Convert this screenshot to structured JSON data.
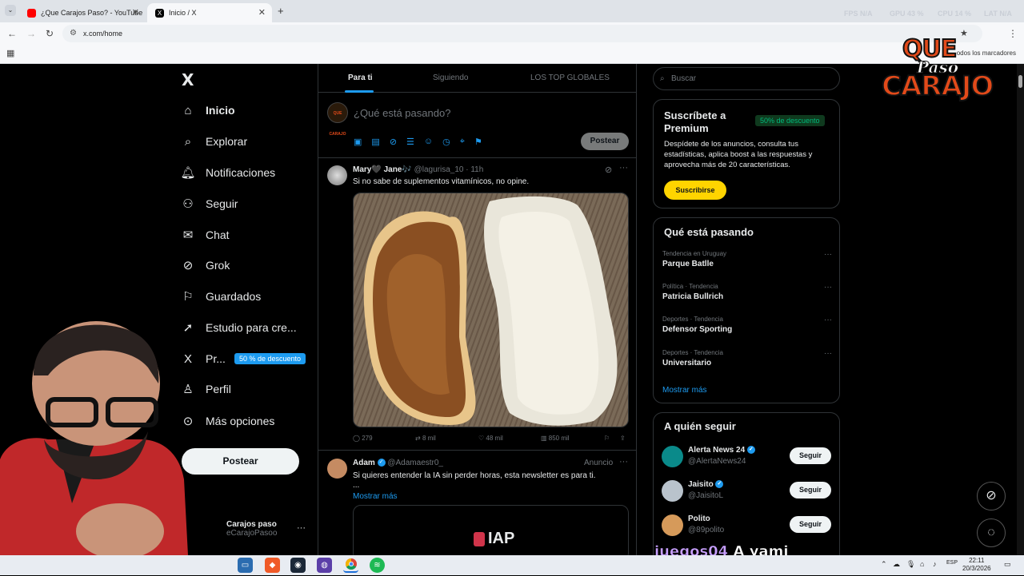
{
  "browser": {
    "tabs": [
      {
        "title": "¿Que Carajos Paso? - YouTube"
      },
      {
        "title": "Inicio / X"
      }
    ],
    "url": "x.com/home",
    "bookmarks_label": "odos los marcadores",
    "stats": {
      "fps": "FPS",
      "fps_val": "N/A",
      "gpu": "GPU",
      "gpu_val": "43 %",
      "cpu": "CPU",
      "cpu_val": "14 %",
      "lat": "LAT",
      "lat_val": "N/A"
    }
  },
  "overlay_logo": {
    "line1": "QUE",
    "line2": "Paso",
    "line3": "CARAJO"
  },
  "sidebar": {
    "logo": "X",
    "items": [
      {
        "label": "Inicio",
        "icon": "home-icon"
      },
      {
        "label": "Explorar",
        "icon": "search-icon"
      },
      {
        "label": "Notificaciones",
        "icon": "bell-icon"
      },
      {
        "label": "Seguir",
        "icon": "add-user-icon"
      },
      {
        "label": "Chat",
        "icon": "mail-icon"
      },
      {
        "label": "Grok",
        "icon": "grok-icon"
      },
      {
        "label": "Guardados",
        "icon": "bookmark-icon"
      },
      {
        "label": "Estudio para cre...",
        "icon": "rocket-icon"
      },
      {
        "label": "Pr...",
        "icon": "x-icon"
      },
      {
        "label": "Perfil",
        "icon": "person-icon"
      },
      {
        "label": "Más opciones",
        "icon": "more-icon"
      }
    ],
    "premium_badge": "50 % de descuento",
    "post_button": "Postear",
    "account": {
      "name": "Carajos paso",
      "handle": "eCarajoPasoo"
    }
  },
  "feed": {
    "tabs": [
      "Para ti",
      "Siguiendo",
      "LOS TOP GLOBALES"
    ],
    "compose": {
      "placeholder": "¿Qué está pasando?",
      "post_label": "Postear",
      "avatar_text": "QUE CARAJO"
    },
    "tweets": [
      {
        "name": "Mary🖤 Jane🎶",
        "handle": "@lagurisa_10",
        "time": "· 11h",
        "text": "Si no sabe de suplementos vitamínicos, no opine.",
        "replies": "279",
        "reposts": "8 mil",
        "likes": "48 mil",
        "views": "850 mil"
      },
      {
        "name": "Adam",
        "handle": "@Adamaestr0_",
        "ad_label": "Anuncio",
        "text": "Si quieres entender la IA sin perder horas, esta newsletter es para ti.",
        "ellipsis": "...",
        "more_link": "Mostrar más",
        "media_logo": "IAP"
      }
    ]
  },
  "right": {
    "search_placeholder": "Buscar",
    "premium": {
      "title": "Suscríbete a Premium",
      "badge": "50% de descuento",
      "text": "Despídete de los anuncios, consulta tus estadísticas, aplica boost a las respuestas y aprovecha más de 20 características.",
      "button": "Suscribirse"
    },
    "trends": {
      "title": "Qué está pasando",
      "items": [
        {
          "category": "Tendencia en Uruguay",
          "topic": "Parque Batlle"
        },
        {
          "category": "Política · Tendencia",
          "topic": "Patricia Bullrich"
        },
        {
          "category": "Deportes · Tendencia",
          "topic": "Defensor Sporting"
        },
        {
          "category": "Deportes · Tendencia",
          "topic": "Universitario"
        }
      ],
      "more": "Mostrar más"
    },
    "who_to_follow": {
      "title": "A quién seguir",
      "items": [
        {
          "name": "Alerta News 24",
          "handle": "@AlertaNews24",
          "button": "Seguir"
        },
        {
          "name": "Jaisito",
          "handle": "@JaisitoL",
          "button": "Seguir"
        },
        {
          "name": "Polito",
          "handle": "@89polito",
          "button": "Seguir"
        }
      ]
    }
  },
  "stream_chat": {
    "user": "juegos04",
    "message": "A yami"
  },
  "taskbar": {
    "lang": "ESP",
    "time": "22:11",
    "date": "20/3/2026"
  },
  "colors": {
    "accent": "#1d9bf0",
    "premium_yellow": "#ffd400",
    "green": "#00ba7c",
    "bg": "#000000"
  }
}
